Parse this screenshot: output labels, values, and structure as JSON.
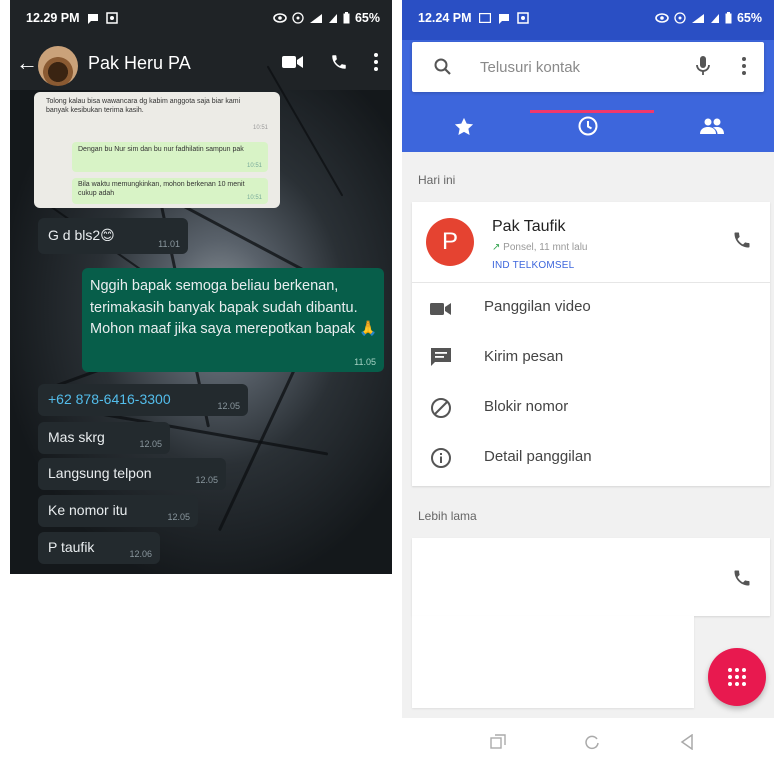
{
  "whatsapp": {
    "status_time": "12.29 PM",
    "status_battery": "65%",
    "contact_name": "Pak Heru PA",
    "quoted": {
      "line1": "Tolong kalau bisa wawancara dg kabim anggota saja biar kami banyak kesibukan terima kasih.",
      "line1_time": "10:51",
      "line2": "Dengan bu Nur sim dan bu nur fadhilatin sampun pak",
      "line2_time": "10:51",
      "line3": "Bila waktu memungkinkan, mohon berkenan 10 menit cukup adah",
      "line3_time": "10:51"
    },
    "messages": [
      {
        "text": "G d bls2😊",
        "time": "11.01"
      },
      {
        "text": "Nggih bapak semoga beliau berkenan, terimakasih banyak bapak sudah dibantu. Mohon maaf jika saya merepotkan bapak 🙏",
        "time": "11.05"
      },
      {
        "text": "+62 878-6416-3300",
        "time": "12.05"
      },
      {
        "text": "Mas skrg",
        "time": "12.05"
      },
      {
        "text": "Langsung telpon",
        "time": "12.05"
      },
      {
        "text": "Ke nomor itu",
        "time": "12.05"
      },
      {
        "text": "P taufik",
        "time": "12.06"
      }
    ],
    "colors": {
      "incoming": "#232a2e",
      "outgoing": "#075e4a",
      "link": "#53bdeb"
    }
  },
  "dialer": {
    "status_time": "12.24 PM",
    "status_battery": "65%",
    "search_placeholder": "Telusuri kontak",
    "today_label": "Hari ini",
    "entry": {
      "avatar_letter": "P",
      "name": "Pak Taufik",
      "subtitle": "Ponsel, 11 mnt lalu",
      "carrier": "IND TELKOMSEL"
    },
    "actions": [
      {
        "label": "Panggilan video",
        "icon": "videocam-icon"
      },
      {
        "label": "Kirim pesan",
        "icon": "message-icon"
      },
      {
        "label": "Blokir nomor",
        "icon": "block-icon"
      },
      {
        "label": "Detail panggilan",
        "icon": "info-icon"
      }
    ],
    "older_label": "Lebih lama",
    "colors": {
      "primary": "#3d66dc",
      "accent": "#e8194f",
      "avatar": "#e54331"
    }
  }
}
